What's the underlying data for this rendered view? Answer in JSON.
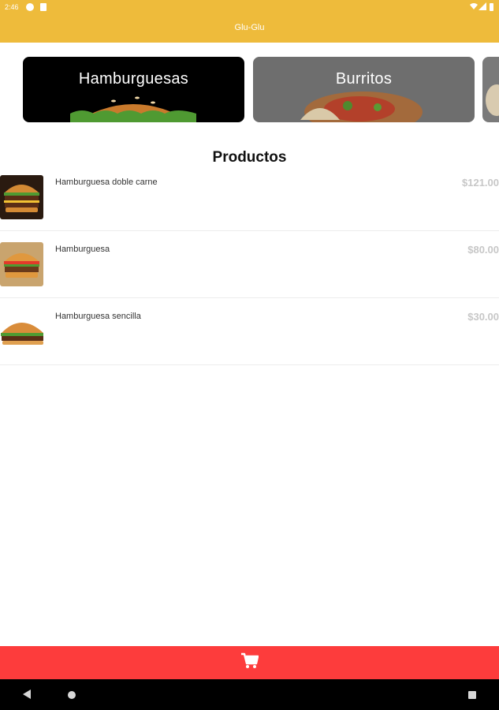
{
  "status_bar": {
    "time": "2:46",
    "icons": [
      "notification-icon",
      "sd-card-icon",
      "wifi-icon",
      "signal-icon",
      "battery-icon"
    ]
  },
  "app": {
    "title": "Glu-Glu",
    "accent_color": "#eebb3b"
  },
  "categories": [
    {
      "label": "Hamburguesas",
      "icon": "burger-image"
    },
    {
      "label": "Burritos",
      "icon": "burrito-image"
    },
    {
      "label": "",
      "icon": "category-image"
    }
  ],
  "products_section": {
    "title": "Productos"
  },
  "products": [
    {
      "name": "Hamburguesa doble carne",
      "price": "$121.00",
      "thumb": "double-burger-image"
    },
    {
      "name": "Hamburguesa",
      "price": "$80.00",
      "thumb": "burger-image"
    },
    {
      "name": "Hamburguesa sencilla",
      "price": "$30.00",
      "thumb": "simple-burger-image"
    }
  ],
  "cart_bar": {
    "icon": "cart-icon",
    "color": "#fd3c3c"
  },
  "nav_bar": {
    "icons": [
      "back-icon",
      "home-icon",
      "recents-icon"
    ]
  }
}
